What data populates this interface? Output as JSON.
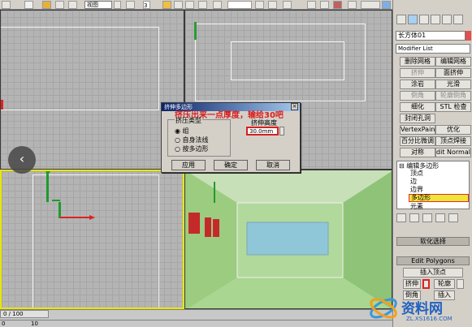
{
  "toolbar": {
    "view_dropdown": "视图",
    "count_field": "3"
  },
  "panel": {
    "object_name": "长方体01",
    "modifier_list": "Modifier List",
    "buttons": [
      {
        "label": "删除网格",
        "disabled": false
      },
      {
        "label": "编辑网格",
        "disabled": false
      },
      {
        "label": "挤伸",
        "disabled": true
      },
      {
        "label": "面挤伸",
        "disabled": false
      },
      {
        "label": "涂岩",
        "disabled": false
      },
      {
        "label": "光滑",
        "disabled": false
      },
      {
        "label": "倒角",
        "disabled": true
      },
      {
        "label": "轮廓倒角",
        "disabled": true
      },
      {
        "label": "细化",
        "disabled": false
      },
      {
        "label": "STL 检查",
        "disabled": false
      },
      {
        "label": "封闭孔洞",
        "disabled": false
      },
      {
        "label": "VertexPaint",
        "disabled": false
      },
      {
        "label": "优化",
        "disabled": false
      },
      {
        "label": "百分比微调",
        "disabled": false
      },
      {
        "label": "顶点焊接",
        "disabled": false
      },
      {
        "label": "对称",
        "disabled": false
      },
      {
        "label": "dit Normal",
        "disabled": false
      }
    ],
    "stack": {
      "root": "编辑多边形",
      "items": [
        "顶点",
        "边",
        "边界",
        "多边形",
        "元素"
      ],
      "selected": "多边形"
    },
    "rollout_soft": "软化选择",
    "rollout_edit": "Edit Polygons",
    "insert_vertex": "插入顶点",
    "extrude": "挤伸",
    "outline": "轮廓",
    "bevel": "倒角",
    "inset": "插入"
  },
  "dialog": {
    "title": "挤伸多边形",
    "annotation": "挤压出来一点厚度，输给30吧",
    "extrude_type_label": "挤压类型",
    "options": [
      "组",
      "自身法线",
      "按多边形"
    ],
    "selected_option": "组",
    "height_label": "挤伸高度",
    "height_value": "30.0mm",
    "apply": "应用",
    "ok": "确定",
    "cancel": "取消"
  },
  "status": {
    "frame": "0 / 100",
    "time_ticks": [
      "0",
      "10"
    ]
  },
  "watermark": {
    "name": "资料网",
    "url": "ZL.XS1616.COM"
  },
  "colors": {
    "selected_stack_item": "#e8292d",
    "dialog_annotation": "#d81f1f",
    "persp_wall": "#a6cf8a",
    "persp_window": "#8fc6d8"
  }
}
